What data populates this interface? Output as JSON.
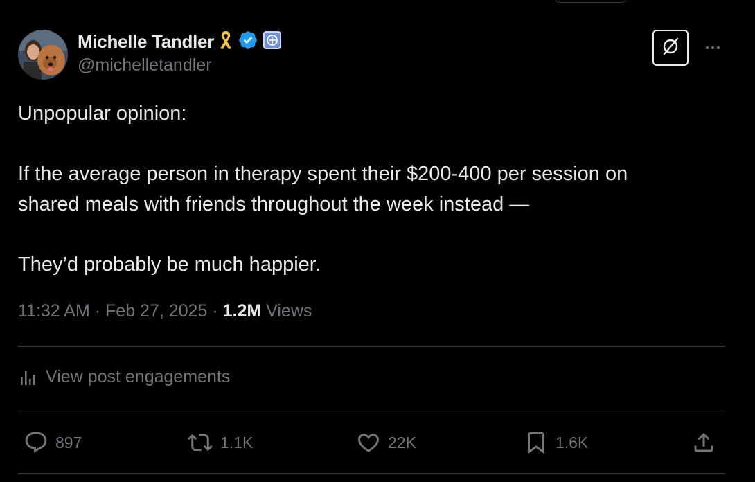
{
  "author": {
    "display_name": "Michelle Tandler",
    "handle": "@michelletandler",
    "verified": true,
    "colors": {
      "verified_badge": "#1d9bf0",
      "ribbon": "#f5c242",
      "affiliate_badge": "#6f8fd8"
    }
  },
  "tweet": {
    "lines": {
      "l1": "Unpopular opinion:",
      "l2": "If the average person in therapy spent their $200-400 per session on",
      "l3": "shared meals with friends throughout the week instead —",
      "l4": "They’d probably be much happier."
    }
  },
  "meta": {
    "time": "11:32 AM",
    "separator": "·",
    "date": "Feb 27, 2025",
    "views_count": "1.2M",
    "views_label": "Views"
  },
  "engagements": {
    "label": "View post engagements",
    "icon": "analytics-icon"
  },
  "actions": {
    "replies": {
      "count": "897",
      "icon": "reply-icon"
    },
    "reposts": {
      "count": "1.1K",
      "icon": "repost-icon"
    },
    "likes": {
      "count": "22K",
      "icon": "like-icon"
    },
    "bookmarks": {
      "count": "1.6K",
      "icon": "bookmark-icon"
    },
    "share": {
      "icon": "share-icon"
    }
  },
  "header_icons": {
    "grok": "grok-icon",
    "more": "more-icon"
  },
  "theme": {
    "background": "#000000",
    "text": "#e7e9ea",
    "muted": "#71767b",
    "divider": "#2f3336"
  }
}
